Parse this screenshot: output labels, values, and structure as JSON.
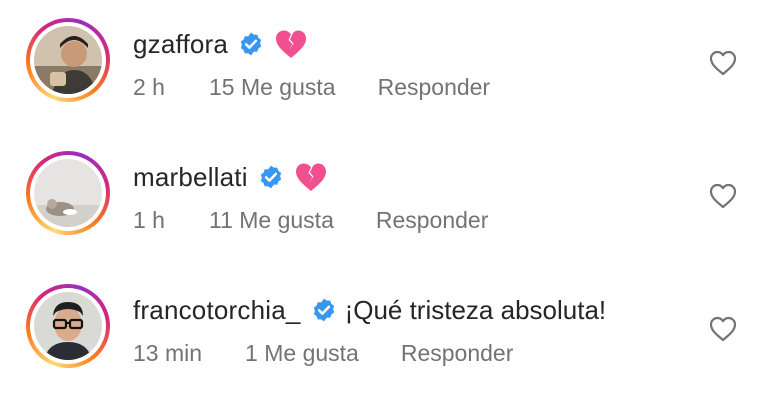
{
  "comments": [
    {
      "username": "gzaffora",
      "text": "",
      "time": "2 h",
      "likes": "15 Me gusta",
      "reply": "Responder",
      "emoji": "broken-heart-emoji"
    },
    {
      "username": "marbellati",
      "text": "",
      "time": "1 h",
      "likes": "11 Me gusta",
      "reply": "Responder",
      "emoji": "broken-heart-emoji"
    },
    {
      "username": "francotorchia_",
      "text": "¡Qué tristeza absoluta!",
      "time": "13 min",
      "likes": "1 Me gusta",
      "reply": "Responder",
      "emoji": ""
    }
  ],
  "colors": {
    "verified": "#3897f0",
    "emoji": "#f0508f",
    "meta_text": "#737373",
    "username": "#262626"
  },
  "icons": {
    "verified": "verified-badge-icon",
    "like": "heart-outline-icon"
  }
}
